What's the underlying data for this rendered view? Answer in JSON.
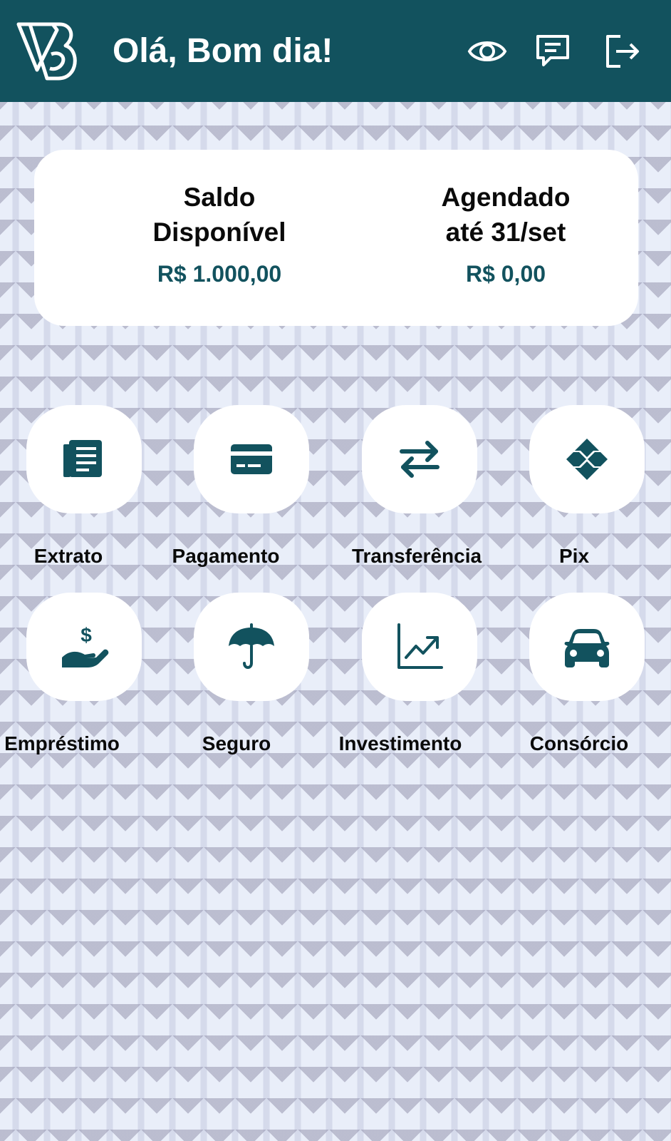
{
  "header": {
    "greeting": "Olá, Bom dia!",
    "icons": [
      "logo",
      "eye-icon",
      "chat-icon",
      "logout-icon"
    ],
    "background_color": "#12525e"
  },
  "balance": {
    "available_label": "Saldo\nDisponível",
    "available_value": "R$ 1.000,00",
    "scheduled_label": "Agendado\naté 31/set",
    "scheduled_value": "R$ 0,00"
  },
  "actions": [
    {
      "label": "Extrato",
      "icon": "statement-icon"
    },
    {
      "label": "Pagamento",
      "icon": "card-icon"
    },
    {
      "label": "Transferência",
      "icon": "transfer-icon"
    },
    {
      "label": "Pix",
      "icon": "pix-icon"
    },
    {
      "label": "Empréstimo",
      "icon": "loan-icon"
    },
    {
      "label": "Seguro",
      "icon": "umbrella-icon"
    },
    {
      "label": "Investimento",
      "icon": "chart-icon"
    },
    {
      "label": "Consórcio",
      "icon": "car-icon"
    }
  ],
  "colors": {
    "accent": "#12525e",
    "card": "#ffffff",
    "text": "#0a0a0a"
  }
}
